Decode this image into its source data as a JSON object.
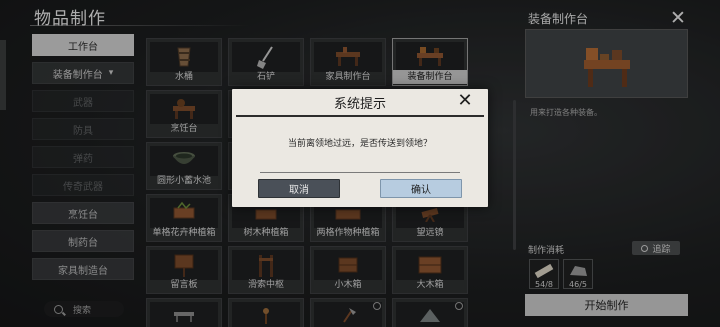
{
  "header": {
    "title": "物品制作"
  },
  "sidebar": {
    "items": [
      {
        "label": "工作台",
        "state": "active"
      },
      {
        "label": "装备制作台",
        "state": "sub"
      },
      {
        "label": "武器",
        "state": "dim"
      },
      {
        "label": "防具",
        "state": "dim"
      },
      {
        "label": "弹药",
        "state": "dim"
      },
      {
        "label": "传奇武器",
        "state": "dim"
      },
      {
        "label": "烹饪台",
        "state": "bright"
      },
      {
        "label": "制药台",
        "state": "bright"
      },
      {
        "label": "家具制造台",
        "state": "bright"
      }
    ],
    "search_placeholder": "搜索"
  },
  "grid": {
    "items": [
      {
        "label": "水桶",
        "icon": "bucket-icon"
      },
      {
        "label": "石铲",
        "icon": "shovel-icon"
      },
      {
        "label": "家具制作台",
        "icon": "furniture-bench-icon"
      },
      {
        "label": "装备制作台",
        "icon": "equipment-bench-icon"
      },
      {
        "label": "烹饪台",
        "icon": "cooking-bench-icon"
      },
      {
        "label": "",
        "icon": ""
      },
      {
        "label": "",
        "icon": ""
      },
      {
        "label": "",
        "icon": ""
      },
      {
        "label": "圆形小蓄水池",
        "icon": "water-basin-icon"
      },
      {
        "label": "",
        "icon": ""
      },
      {
        "label": "",
        "icon": ""
      },
      {
        "label": "",
        "icon": ""
      },
      {
        "label": "单格花卉种植箱",
        "icon": "flower-planter-icon"
      },
      {
        "label": "树木种植箱",
        "icon": "tree-planter-icon"
      },
      {
        "label": "两格作物种植箱",
        "icon": "crop-planter-icon"
      },
      {
        "label": "望远镜",
        "icon": "telescope-icon"
      },
      {
        "label": "留言板",
        "icon": "message-board-icon"
      },
      {
        "label": "滑索中枢",
        "icon": "zipline-hub-icon"
      },
      {
        "label": "小木箱",
        "icon": "small-crate-icon"
      },
      {
        "label": "大木箱",
        "icon": "large-crate-icon"
      },
      {
        "label": "",
        "icon": "table-icon"
      },
      {
        "label": "",
        "icon": "lamp-icon"
      },
      {
        "label": "",
        "icon": "axe-icon"
      },
      {
        "label": "",
        "icon": "tent-icon"
      }
    ]
  },
  "panel": {
    "title": "装备制作台",
    "description": "用来打造各种装备。",
    "consume_label": "制作消耗",
    "trace_label": "追踪",
    "materials": [
      {
        "icon": "wood-log-icon",
        "count": "54/8"
      },
      {
        "icon": "stone-icon",
        "count": "46/5"
      }
    ],
    "start_label": "开始制作"
  },
  "dialog": {
    "title": "系统提示",
    "message": "当前离领地过远，是否传送到领地？",
    "cancel_label": "取消",
    "confirm_label": "确认"
  },
  "colors": {
    "dialog_bg": "#ebe8e2",
    "cancel_btn": "#4a5058",
    "confirm_btn": "#b7cce0",
    "active_tab": "#cfcfcf"
  }
}
